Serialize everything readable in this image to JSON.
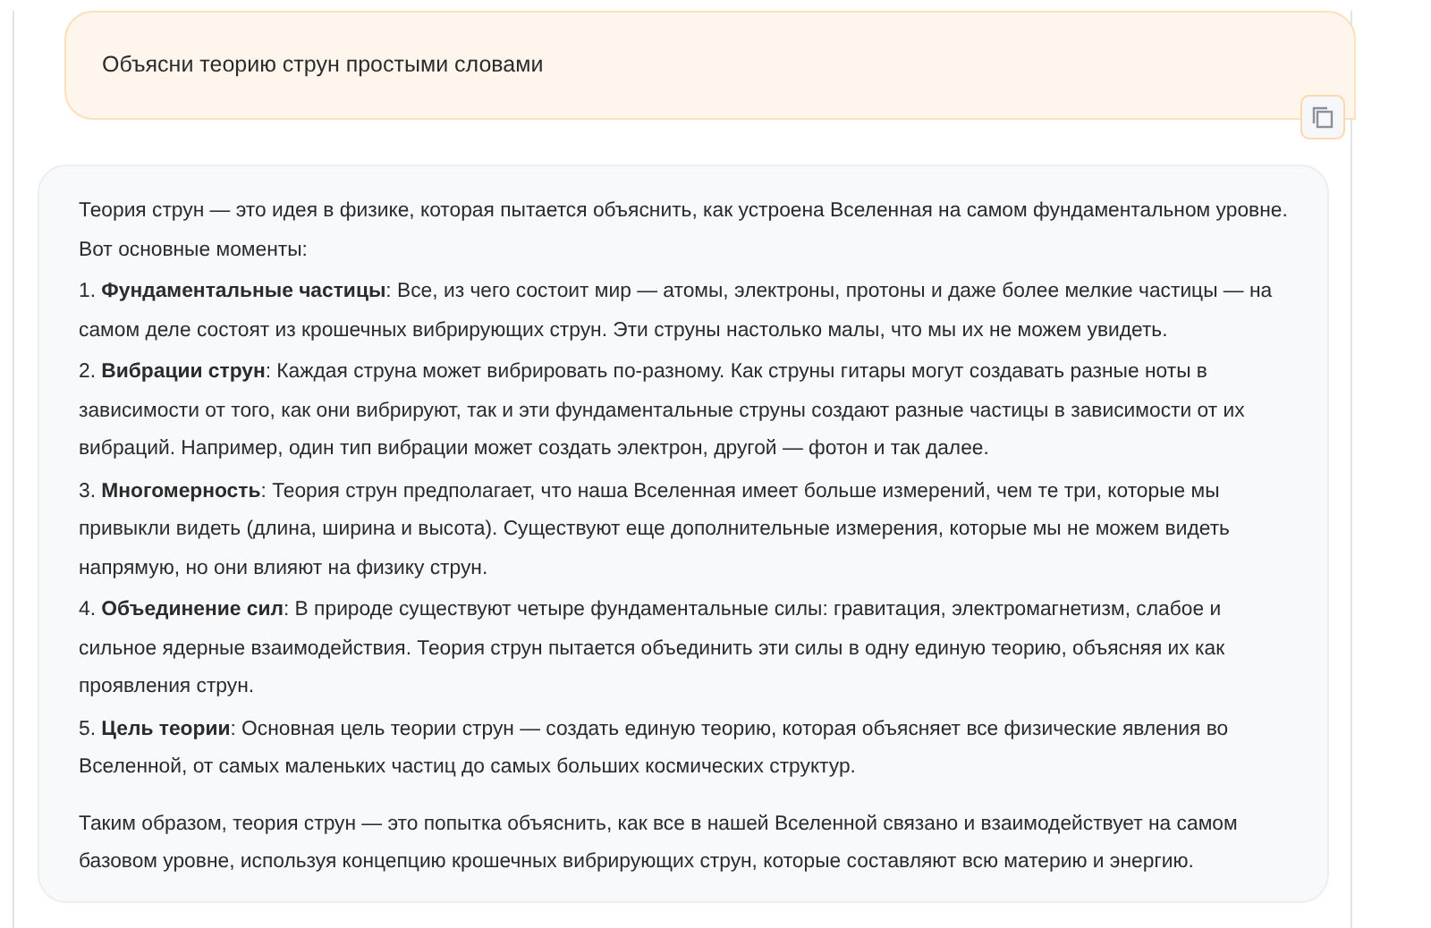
{
  "prompt": {
    "text": "Объясни теорию струн простыми словами"
  },
  "answer": {
    "intro": "Теория струн — это идея в физике, которая пытается объяснить, как устроена Вселенная на самом фундаментальном уровне. Вот основные моменты:",
    "items": [
      "1. **Фундаментальные частицы**: Все, из чего состоит мир — атомы, электроны, протоны и даже более мелкие частицы — на самом деле состоят из крошечных вибрирующих струн. Эти струны настолько малы, что мы их не можем увидеть.",
      "2. **Вибрации струн**: Каждая струна может вибрировать по-разному. Как струны гитары могут создавать разные ноты в зависимости от того, как они вибрируют, так и эти фундаментальные струны создают разные частицы в зависимости от их вибраций. Например, один тип вибрации может создать электрон, другой — фотон и так далее.",
      "3. **Многомерность**: Теория струн предполагает, что наша Вселенная имеет больше измерений, чем те три, которые мы привыкли видеть (длина, ширина и высота). Существуют еще дополнительные измерения, которые мы не можем видеть напрямую, но они влияют на физику струн.",
      "4. **Объединение сил**: В природе существуют четыре фундаментальные силы: гравитация, электромагнетизм, слабое и сильное ядерные взаимодействия. Теория струн пытается объединить эти силы в одну единую теорию, объясняя их как проявления струн.",
      "5. **Цель теории**: Основная цель теории струн — создать единую теорию, которая объясняет все физические явления во Вселенной, от самых маленьких частиц до самых больших космических структур."
    ],
    "conclusion": "Таким образом, теория струн — это попытка объяснить, как все в нашей Вселенной связано и взаимодействует на самом базовом уровне, используя концепцию крошечных вибрирующих струн, которые составляют всю материю и энергию."
  }
}
